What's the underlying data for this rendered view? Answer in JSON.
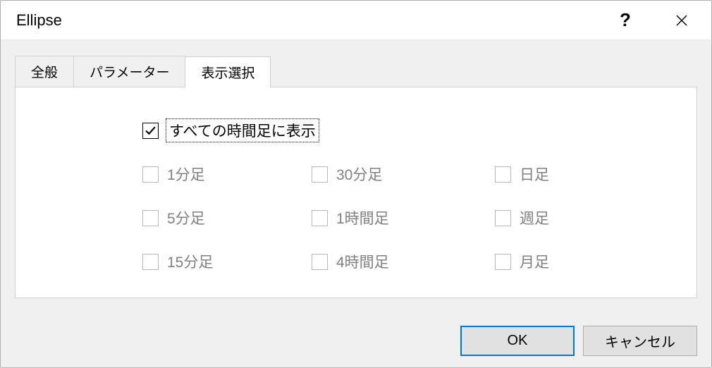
{
  "title": "Ellipse",
  "tabs": {
    "general": "全般",
    "parameters": "パラメーター",
    "display": "表示選択"
  },
  "activeTab": 2,
  "display": {
    "master": "すべての時間足に表示",
    "masterChecked": true,
    "timeframes": {
      "m1": "1分足",
      "m5": "5分足",
      "m15": "15分足",
      "m30": "30分足",
      "h1": "1時間足",
      "h4": "4時間足",
      "d1": "日足",
      "w1": "週足",
      "mn": "月足"
    }
  },
  "buttons": {
    "ok": "OK",
    "cancel": "キャンセル"
  }
}
